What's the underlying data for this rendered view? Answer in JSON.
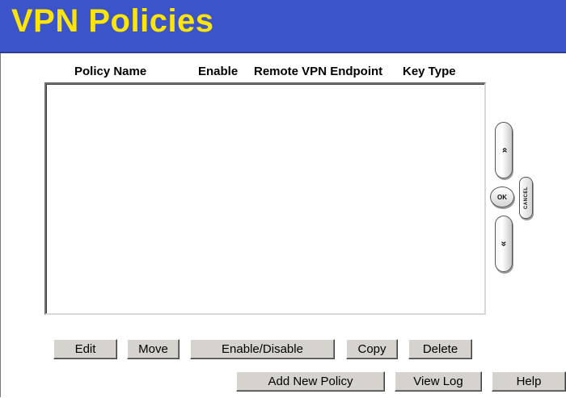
{
  "header": {
    "title": "VPN Policies"
  },
  "table": {
    "columns": [
      "Policy Name",
      "Enable",
      "Remote VPN Endpoint",
      "Key Type"
    ],
    "rows": []
  },
  "actions": {
    "edit": "Edit",
    "move": "Move",
    "enable_disable": "Enable/Disable",
    "copy": "Copy",
    "delete": "Delete",
    "add_new_policy": "Add New Policy",
    "view_log": "View Log",
    "help": "Help"
  },
  "remote": {
    "up_icon": "»",
    "down_icon": "»",
    "ok": "OK",
    "cancel": "CANCEL"
  },
  "colors": {
    "title_bar": "#3b54c9",
    "title_text": "#ffe600",
    "button_face": "#d6d3ce"
  }
}
